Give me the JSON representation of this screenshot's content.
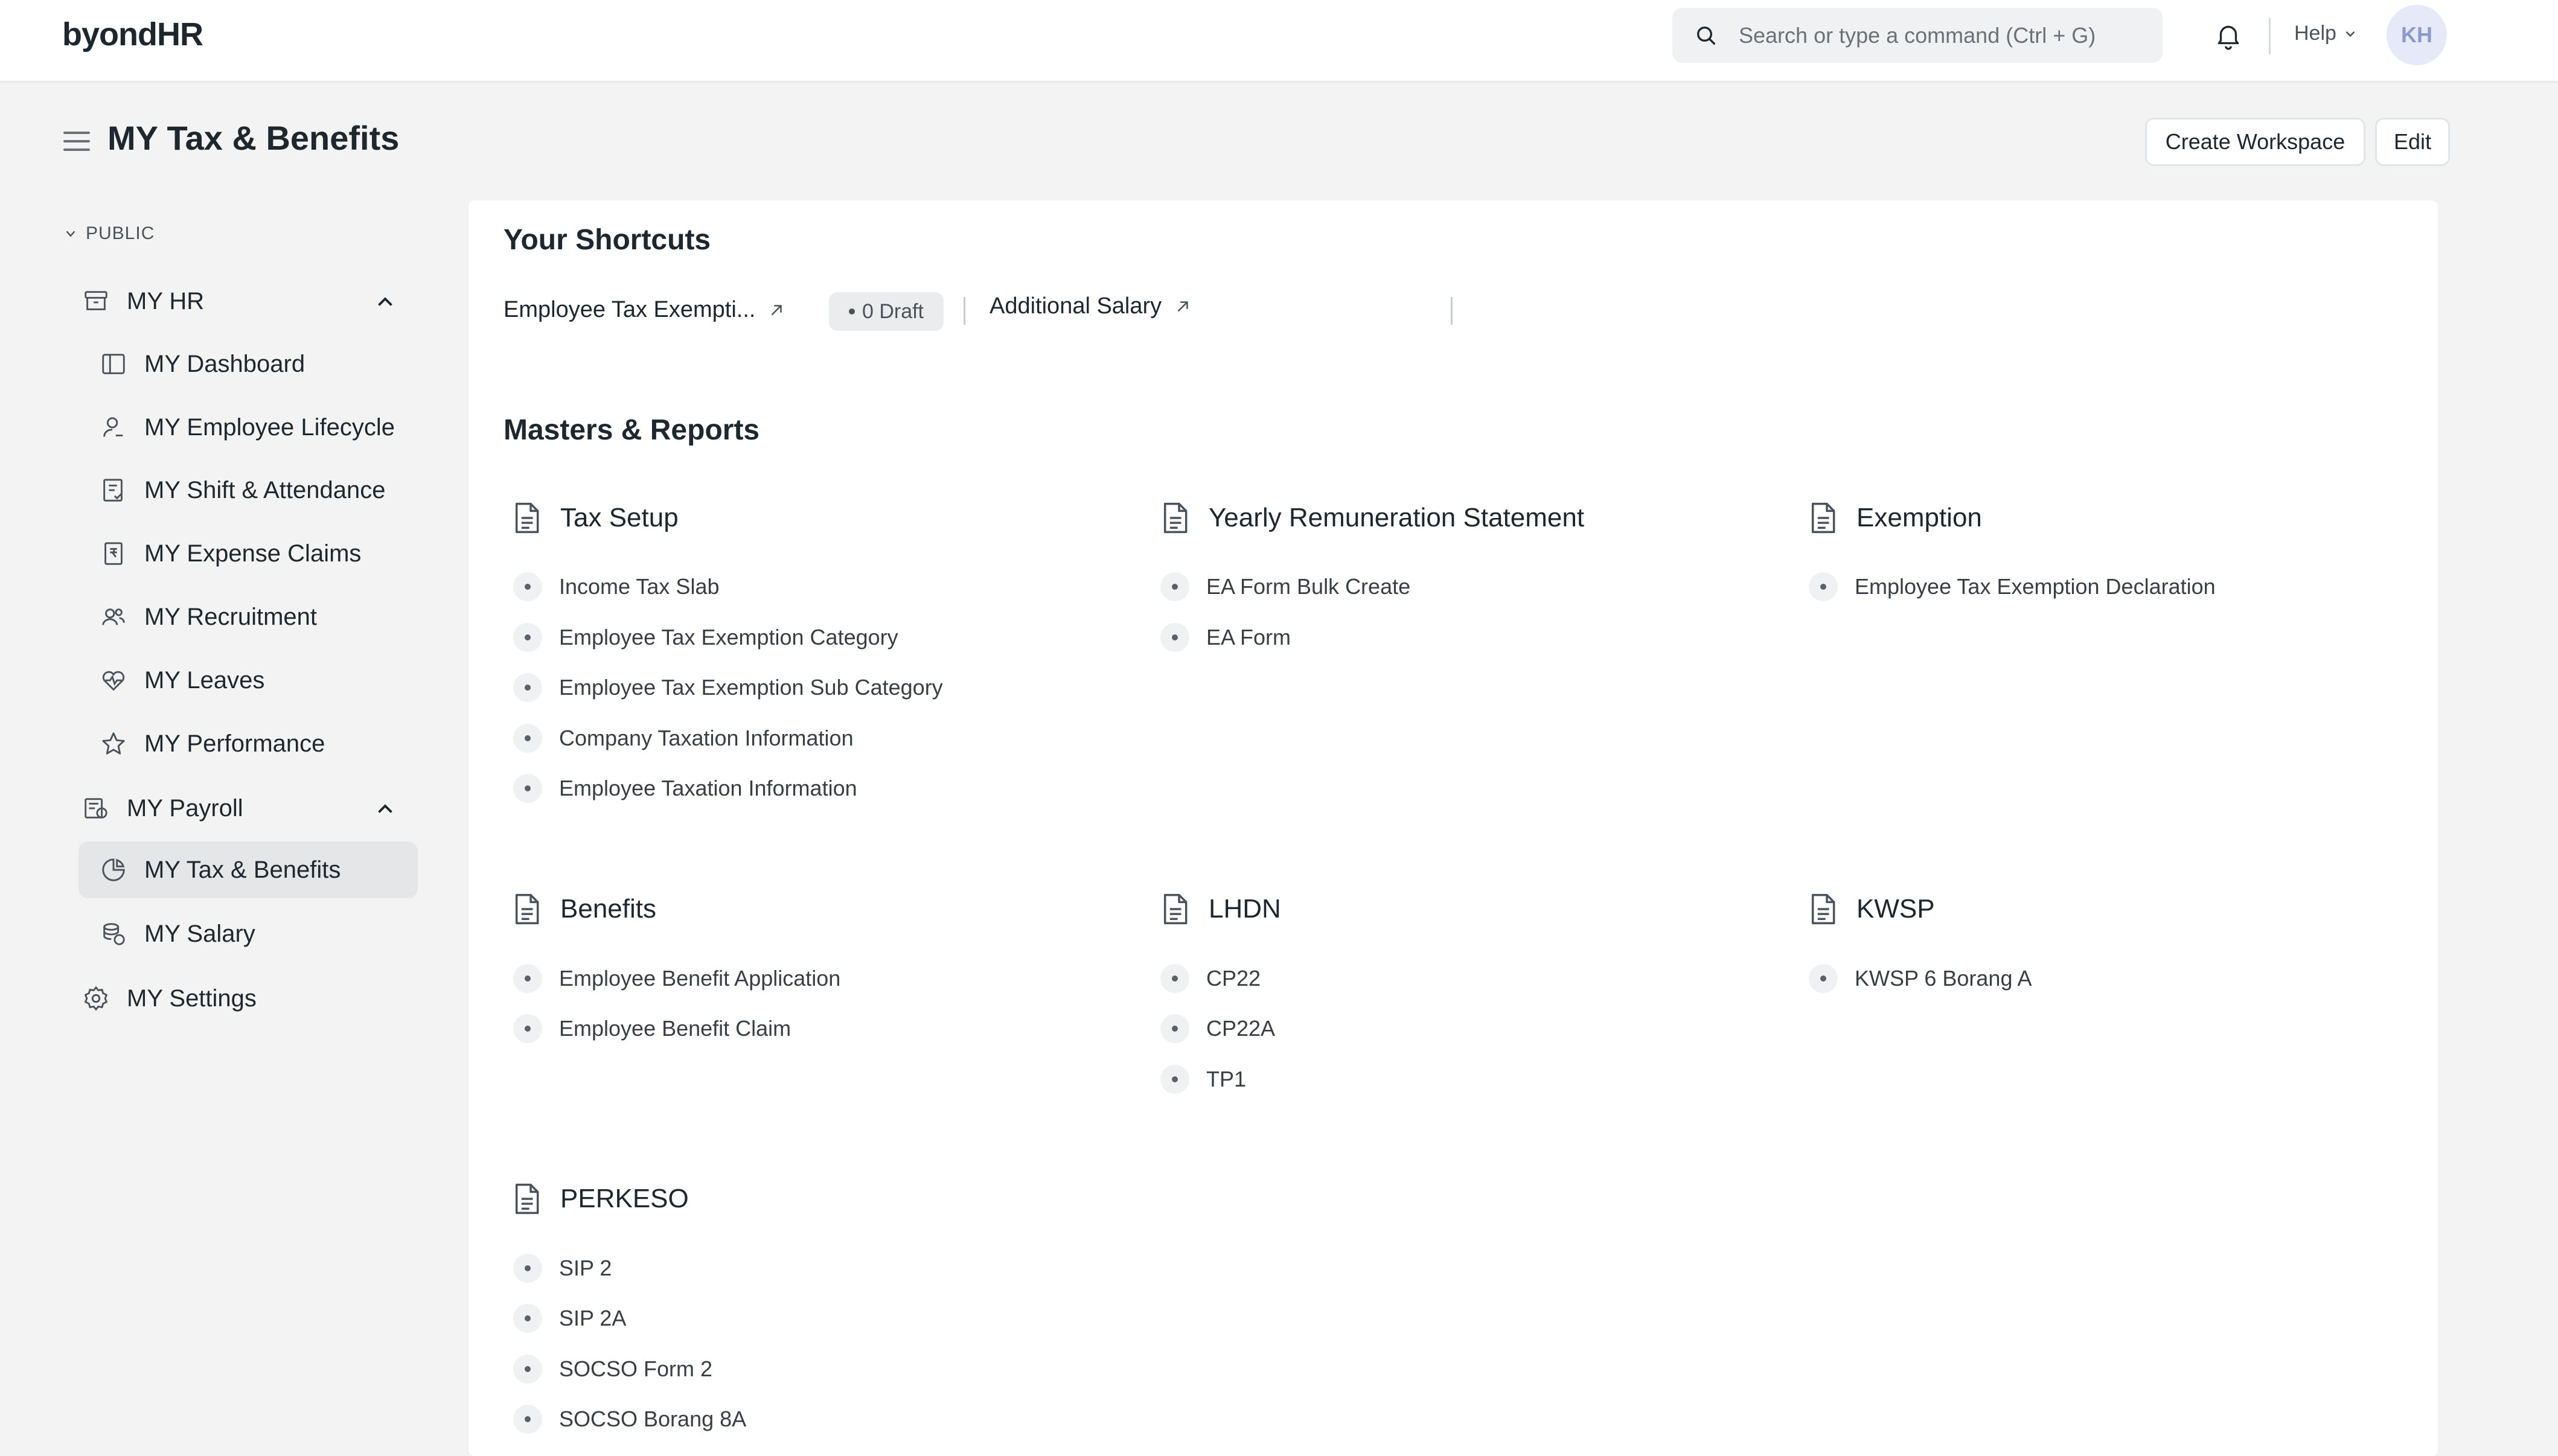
{
  "navbar": {
    "brand_prefix": "byond",
    "brand_suffix": "HR",
    "search_placeholder": "Search or type a command (Ctrl + G)",
    "help_label": "Help",
    "avatar_initials": "KH"
  },
  "page": {
    "title": "MY Tax & Benefits",
    "create_workspace_label": "Create Workspace",
    "edit_label": "Edit"
  },
  "sidebar": {
    "section_label": "PUBLIC",
    "items": [
      {
        "label": "MY HR",
        "icon": "folder-icon"
      },
      {
        "label": "MY Dashboard",
        "icon": "dashboard-icon"
      },
      {
        "label": "MY Employee Lifecycle",
        "icon": "user-icon"
      },
      {
        "label": "MY Shift & Attendance",
        "icon": "attendance-icon"
      },
      {
        "label": "MY Expense Claims",
        "icon": "expense-icon"
      },
      {
        "label": "MY Recruitment",
        "icon": "users-icon"
      },
      {
        "label": "MY Leaves",
        "icon": "leaves-icon"
      },
      {
        "label": "MY Performance",
        "icon": "star-icon"
      },
      {
        "label": "MY Payroll",
        "icon": "payroll-icon"
      },
      {
        "label": "MY Tax & Benefits",
        "icon": "tax-icon",
        "active": true
      },
      {
        "label": "MY Salary",
        "icon": "salary-icon"
      },
      {
        "label": "MY Settings",
        "icon": "gear-icon"
      }
    ]
  },
  "shortcuts": {
    "heading": "Your Shortcuts",
    "items": [
      {
        "label": "Employee Tax Exempti...",
        "badge": "0 Draft"
      },
      {
        "label": "Additional Salary"
      }
    ]
  },
  "masters": {
    "heading": "Masters & Reports",
    "groups": [
      {
        "title": "Tax Setup",
        "links": [
          "Income Tax Slab",
          "Employee Tax Exemption Category",
          "Employee Tax Exemption Sub Category",
          "Company Taxation Information",
          "Employee Taxation Information"
        ]
      },
      {
        "title": "Yearly Remuneration Statement",
        "links": [
          "EA Form Bulk Create",
          "EA Form"
        ]
      },
      {
        "title": "Exemption",
        "links": [
          "Employee Tax Exemption Declaration"
        ]
      },
      {
        "title": "Benefits",
        "links": [
          "Employee Benefit Application",
          "Employee Benefit Claim"
        ]
      },
      {
        "title": "LHDN",
        "links": [
          "CP22",
          "CP22A",
          "TP1"
        ]
      },
      {
        "title": "KWSP",
        "links": [
          "KWSP 6 Borang A"
        ]
      },
      {
        "title": "PERKESO",
        "links": [
          "SIP 2",
          "SIP 2A",
          "SOCSO Form 2",
          "SOCSO Borang 8A"
        ]
      }
    ]
  }
}
